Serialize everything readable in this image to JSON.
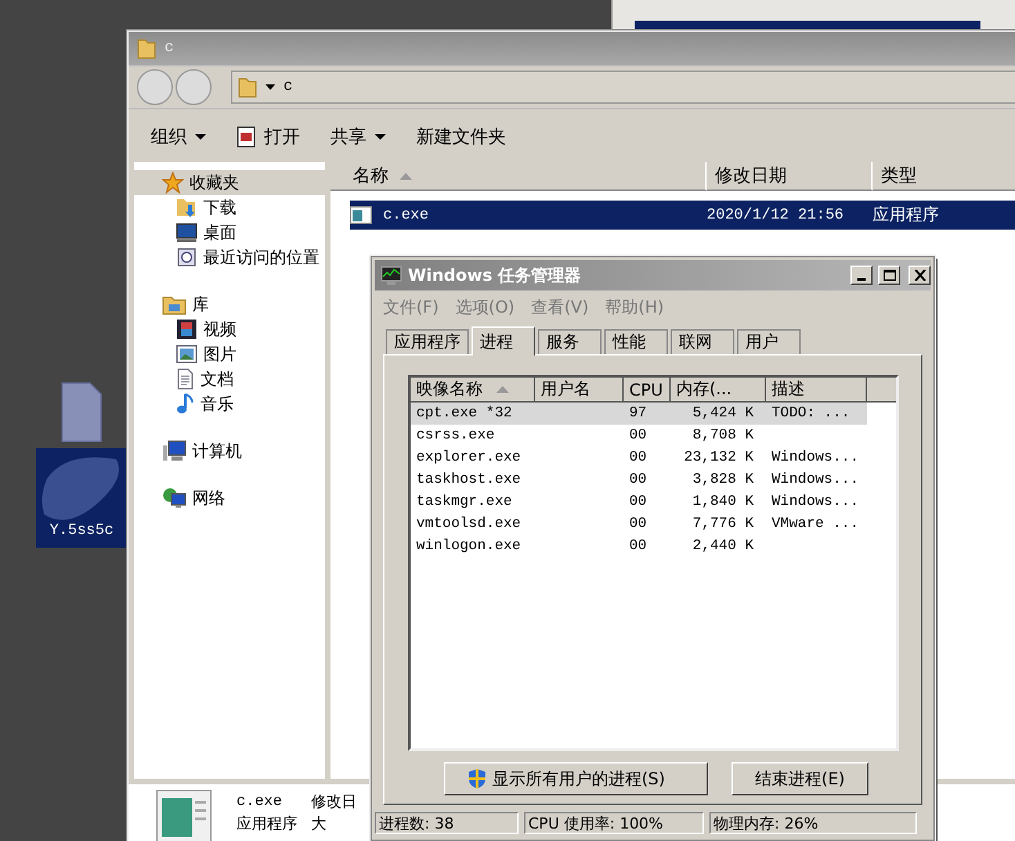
{
  "desktop": {
    "icons": [
      {
        "label": "Y.5ss5c",
        "selected": true,
        "blurred": true
      }
    ]
  },
  "explorer": {
    "title": "c",
    "address": "c",
    "toolbar": [
      {
        "label": "组织",
        "kind": "menu"
      },
      {
        "label": "打开",
        "kind": "open"
      },
      {
        "label": "共享",
        "kind": "menu"
      },
      {
        "label": "新建文件夹",
        "kind": "plain"
      }
    ],
    "nav": [
      {
        "label": "收藏夹",
        "kind": "star",
        "selected": true,
        "children": [
          {
            "label": "下载",
            "kind": "download",
            "selected": false
          },
          {
            "label": "桌面",
            "kind": "desktop",
            "selected": false
          },
          {
            "label": "最近访问的位置",
            "kind": "recent",
            "selected": false
          }
        ]
      },
      {
        "label": "库",
        "kind": "library",
        "selected": false,
        "children": [
          {
            "label": "视频",
            "kind": "video",
            "selected": false
          },
          {
            "label": "图片",
            "kind": "pictures",
            "selected": false
          },
          {
            "label": "文档",
            "kind": "documents",
            "selected": false
          },
          {
            "label": "音乐",
            "kind": "music",
            "selected": false
          }
        ]
      },
      {
        "label": "计算机",
        "kind": "computer",
        "selected": false
      },
      {
        "label": "网络",
        "kind": "network",
        "selected": false
      }
    ],
    "columns": [
      {
        "label": "名称",
        "sorted": true
      },
      {
        "label": "修改日期",
        "sorted": false
      },
      {
        "label": "类型",
        "sorted": false
      }
    ],
    "files": [
      {
        "name": "c.exe",
        "modified": "2020/1/12 21:56",
        "type": "应用程序",
        "selected": true
      }
    ],
    "details": {
      "name": "c.exe",
      "modified_label": "修改日",
      "type": "应用程序",
      "size_label": "大"
    }
  },
  "task_manager": {
    "title": "Windows 任务管理器",
    "menu": [
      "文件(F)",
      "选项(O)",
      "查看(V)",
      "帮助(H)"
    ],
    "tabs": [
      {
        "label": "应用程序",
        "selected": false
      },
      {
        "label": "进程",
        "selected": true
      },
      {
        "label": "服务",
        "selected": false
      },
      {
        "label": "性能",
        "selected": false
      },
      {
        "label": "联网",
        "selected": false
      },
      {
        "label": "用户",
        "selected": false
      }
    ],
    "columns": [
      {
        "label": "映像名称",
        "sorted": true
      },
      {
        "label": "用户名",
        "sorted": false
      },
      {
        "label": "CPU",
        "sorted": false
      },
      {
        "label": "内存(...",
        "sorted": false
      },
      {
        "label": "描述",
        "sorted": false
      }
    ],
    "processes": [
      {
        "image": "cpt.exe *32",
        "cpu": "97",
        "memory": "5,424 K",
        "description": "TODO: ...",
        "selected": true
      },
      {
        "image": "csrss.exe",
        "cpu": "00",
        "memory": "8,708 K",
        "selected": false
      },
      {
        "image": "explorer.exe",
        "cpu": "00",
        "memory": "23,132 K",
        "description": "Windows...",
        "selected": false
      },
      {
        "image": "taskhost.exe",
        "cpu": "00",
        "memory": "3,828 K",
        "description": "Windows...",
        "selected": false
      },
      {
        "image": "taskmgr.exe",
        "cpu": "00",
        "memory": "1,840 K",
        "description": "Windows...",
        "selected": false
      },
      {
        "image": "vmtoolsd.exe",
        "cpu": "00",
        "memory": "7,776 K",
        "description": "VMware ...",
        "selected": false
      },
      {
        "image": "winlogon.exe",
        "cpu": "00",
        "memory": "2,440 K",
        "selected": false
      }
    ],
    "buttons": [
      {
        "label": "显示所有用户的进程(S)",
        "kind": "shield"
      },
      {
        "label": "结束进程(E)",
        "kind": "plain"
      }
    ],
    "status": [
      "进程数: 38",
      "CPU 使用率: 100%",
      "物理内存: 26%"
    ]
  }
}
